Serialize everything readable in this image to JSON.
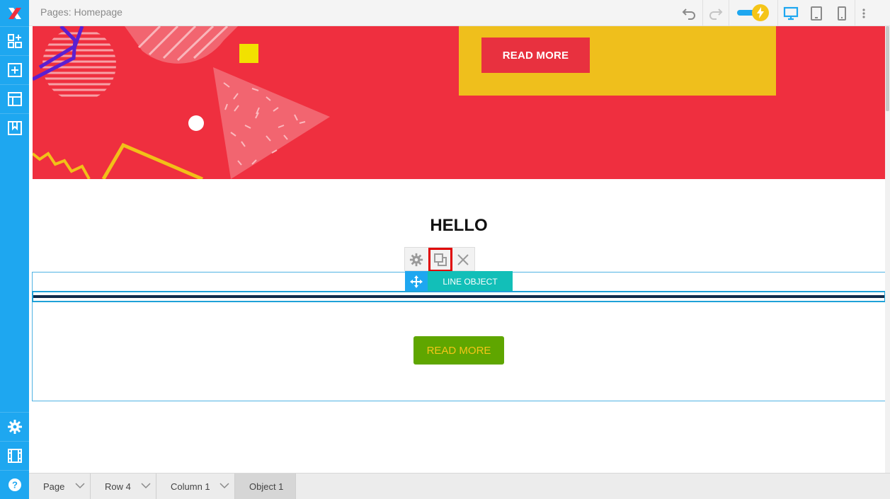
{
  "app": {
    "breadcrumb": "Pages: Homepage",
    "accent_color": "#1ea7f0",
    "logo_icon": "x-logo-icon"
  },
  "sidebar": {
    "top_items": [
      {
        "icon": "widgets-icon"
      },
      {
        "icon": "add-box-icon"
      },
      {
        "icon": "layout-icon"
      },
      {
        "icon": "bookmark-icon"
      }
    ],
    "bottom_items": [
      {
        "icon": "gear-icon"
      },
      {
        "icon": "film-icon"
      },
      {
        "icon": "help-icon"
      }
    ]
  },
  "toolbar": {
    "undo_icon": "undo-icon",
    "redo_icon": "redo-icon",
    "power_toggle_icon": "lightning-icon",
    "devices": [
      "desktop-icon",
      "tablet-icon",
      "mobile-icon"
    ],
    "more_icon": "more-vertical-icon"
  },
  "canvas": {
    "hero": {
      "button_label": "READ MORE",
      "bg_color": "#ef2f3f",
      "panel_color": "#efbf1c"
    },
    "heading": "HELLO",
    "object_toolbar": {
      "settings_icon": "gear-icon",
      "duplicate_icon": "duplicate-icon",
      "delete_icon": "close-icon"
    },
    "object_label": "LINE OBJECT",
    "cta_button_label": "READ MORE",
    "cta_button_color": "#5fa600"
  },
  "bottombar": {
    "items": [
      {
        "label": "Page"
      },
      {
        "label": "Row 4"
      },
      {
        "label": "Column 1"
      },
      {
        "label": "Object 1"
      }
    ]
  }
}
